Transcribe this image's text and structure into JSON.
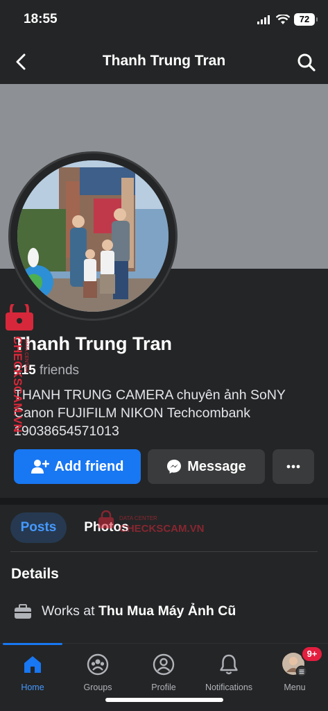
{
  "status_bar": {
    "time": "18:55",
    "battery": "72"
  },
  "nav": {
    "title": "Thanh Trung Tran"
  },
  "profile": {
    "name": "Thanh Trung Tran",
    "friends_count": "215",
    "friends_label": "friends",
    "bio": "THANH TRUNG CAMERA   chuyên ảnh SoNY Canon FUJIFILM NIKON   Techcombank 19038654571013"
  },
  "actions": {
    "add_friend": "Add friend",
    "message": "Message"
  },
  "tabs": [
    {
      "label": "Posts",
      "active": true
    },
    {
      "label": "Photos",
      "active": false
    }
  ],
  "details": {
    "heading": "Details",
    "work_prefix": "Works at ",
    "work_place": "Thu Mua Máy Ảnh Cũ"
  },
  "bottom_nav": [
    {
      "label": "Home",
      "icon": "home-icon",
      "active": true
    },
    {
      "label": "Groups",
      "icon": "groups-icon",
      "active": false
    },
    {
      "label": "Profile",
      "icon": "profile-icon",
      "active": false
    },
    {
      "label": "Notifications",
      "icon": "bell-icon",
      "active": false
    },
    {
      "label": "Menu",
      "icon": "menu-avatar",
      "active": false
    }
  ],
  "menu_badge": "9+",
  "watermark": {
    "vertical": "CHECKSCAM.VN",
    "small": "DATA CENTER",
    "horizontal": "CHECKSCAM.VN"
  },
  "colors": {
    "accent": "#1877f2",
    "background": "#242526",
    "cover": "#8d9196",
    "badge": "#e41e3f",
    "watermark": "#d6283a"
  }
}
